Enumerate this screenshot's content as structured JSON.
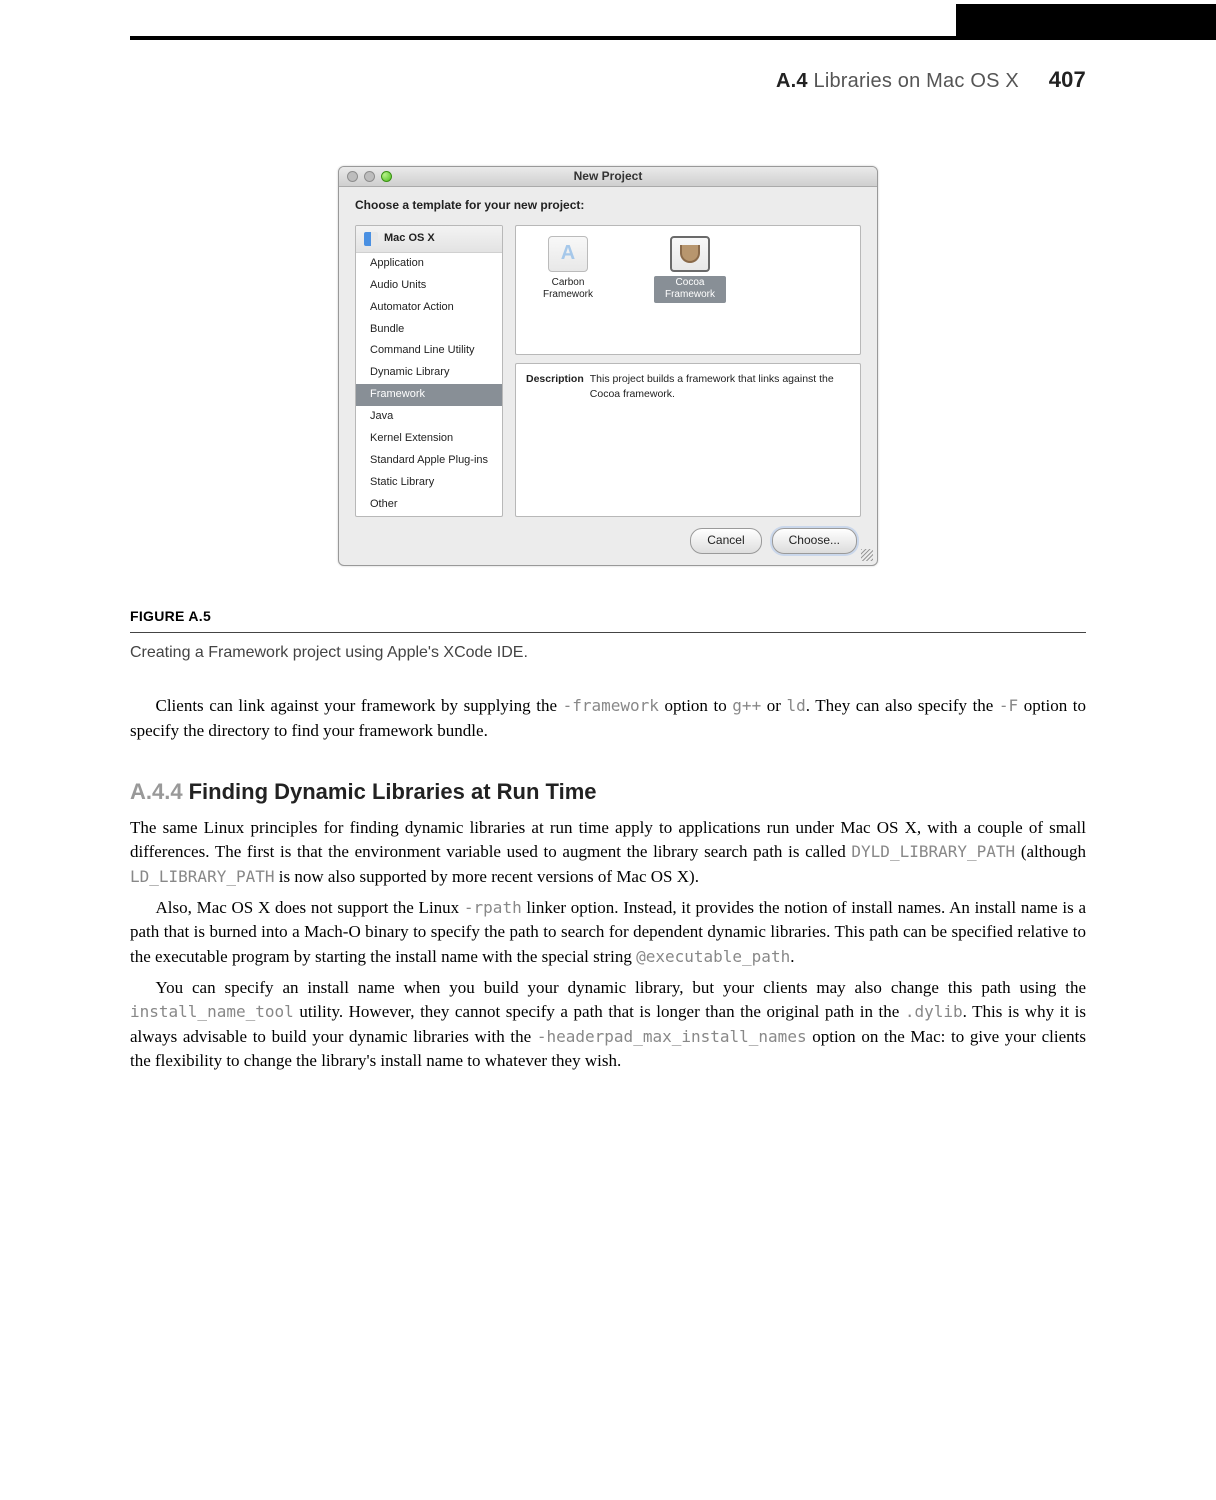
{
  "header": {
    "section_num": "A.4",
    "section_title": "Libraries on Mac OS X",
    "page_number": "407"
  },
  "dialog": {
    "title": "New Project",
    "subhead": "Choose a template for your new project:",
    "section_header": "Mac OS X",
    "sidebar_items": [
      "Application",
      "Audio Units",
      "Automator Action",
      "Bundle",
      "Command Line Utility",
      "Dynamic Library",
      "Framework",
      "Java",
      "Kernel Extension",
      "Standard Apple Plug-ins",
      "Static Library",
      "Other"
    ],
    "selected_sidebar": "Framework",
    "templates": [
      {
        "label": "Carbon Framework",
        "selected": false
      },
      {
        "label": "Cocoa Framework",
        "selected": true
      }
    ],
    "description_label": "Description",
    "description_text": "This project builds a framework that links against the Cocoa framework.",
    "cancel_label": "Cancel",
    "choose_label": "Choose..."
  },
  "figure": {
    "label": "FIGURE A.5",
    "caption": "Creating a Framework project using Apple's XCode IDE."
  },
  "para1_a": "Clients can link against your framework by supplying the ",
  "para1_code1": "-framework",
  "para1_b": " option to ",
  "para1_code2": "g++",
  "para1_c": " or ",
  "para1_code3": "ld",
  "para1_d": ". They can also specify the ",
  "para1_code4": "-F",
  "para1_e": " option to specify the directory to find your framework bundle.",
  "section": {
    "num": "A.4.4",
    "title": "Finding Dynamic Libraries at Run Time"
  },
  "para2_a": "The same Linux principles for finding dynamic libraries at run time apply to applications run under Mac OS X, with a couple of small differences. The first is that the environment variable used to augment the library search path is called ",
  "para2_code1": "DYLD_LIBRARY_PATH",
  "para2_b": " (although ",
  "para2_code2": "LD_LIBRARY_PATH",
  "para2_c": " is now also supported by more recent versions of Mac OS X).",
  "para3_a": "Also, Mac OS X does not support the Linux ",
  "para3_code1": "-rpath",
  "para3_b": " linker option. Instead, it provides the notion of install names. An install name is a path that is burned into a Mach-O binary to specify the path to search for dependent dynamic libraries. This path can be specified relative to the executable program by starting the install name with the special string ",
  "para3_code2": "@executable_path",
  "para3_c": ".",
  "para4_a": "You can specify an install name when you build your dynamic library, but your clients may also change this path using the ",
  "para4_code1": "install_name_tool",
  "para4_b": " utility. However, they cannot specify a path that is longer than the original path in the ",
  "para4_code2": ".dylib",
  "para4_c": ". This is why it is always advisable to build your dynamic libraries with the ",
  "para4_code3": "-headerpad_max_install_names",
  "para4_d": " option on the Mac: to give your clients the flexibility to change the library's install name to whatever they wish."
}
